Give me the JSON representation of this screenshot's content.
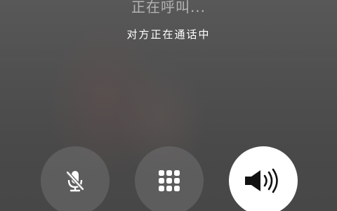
{
  "call": {
    "status_text": "正在呼叫...",
    "subtitle": "对方正在通话中"
  },
  "controls": [
    {
      "name": "mute",
      "icon": "microphone-off-icon",
      "active": false
    },
    {
      "name": "keypad",
      "icon": "keypad-icon",
      "active": false
    },
    {
      "name": "speaker",
      "icon": "speaker-icon",
      "active": true
    }
  ],
  "colors": {
    "background": "#4f4f4f",
    "button_inactive": "#787878",
    "button_active": "#ffffff",
    "icon_light": "#ffffff",
    "icon_dark": "#111111"
  }
}
